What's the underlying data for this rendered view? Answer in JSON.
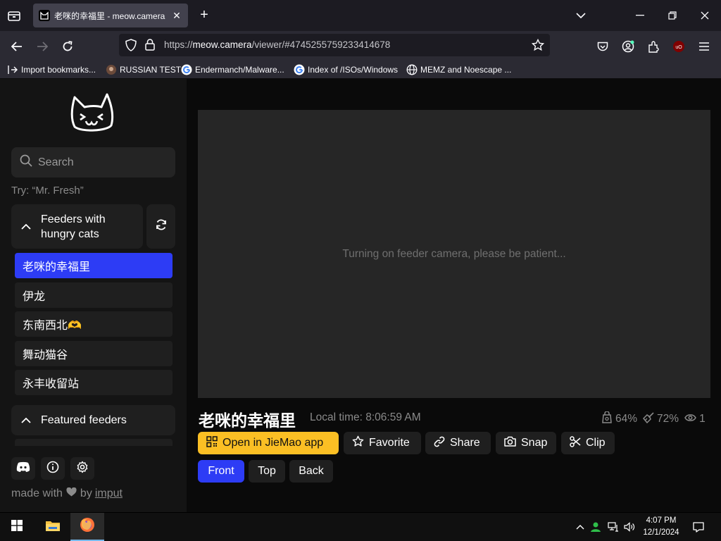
{
  "browser": {
    "tab_title": "老咪的幸福里 - meow.camera",
    "url_prefix": "https://",
    "url_host": "meow.camera",
    "url_path": "/viewer/#4745255759233414678",
    "bookmarks": [
      {
        "label": "Import bookmarks...",
        "icon": "import-icon"
      },
      {
        "label": "RUSSIAN TEST",
        "icon": "site-favicon"
      },
      {
        "label": "Endermanch/Malware...",
        "icon": "google-icon"
      },
      {
        "label": "Index of /ISOs/Windows",
        "icon": "google-icon"
      },
      {
        "label": "MEMZ and Noescape ...",
        "icon": "globe-icon"
      }
    ]
  },
  "sidebar": {
    "search_placeholder": "Search",
    "try_hint": "Try: “Mr. Fresh”",
    "group_hungry": "Feeders with hungry cats",
    "feeders": [
      "老咪的幸福里",
      "伊龙",
      "东南西北🫶",
      "舞动猫谷",
      "永丰收留站"
    ],
    "active_index": 0,
    "group_featured": "Featured feeders",
    "made_with": "made with",
    "by": "by",
    "author": "imput"
  },
  "viewer": {
    "status_message": "Turning on feeder camera, please be patient...",
    "feeder_name": "老咪的幸福里",
    "local_time": "Local time: 8:06:59 AM",
    "food_level": "64%",
    "cleanliness": "72%",
    "viewers": "1",
    "actions": {
      "open_app": "Open in JieMao app",
      "favorite": "Favorite",
      "share": "Share",
      "snap": "Snap",
      "clip": "Clip"
    },
    "cameras": [
      "Front",
      "Top",
      "Back"
    ],
    "active_camera": "Front"
  },
  "taskbar": {
    "time": "4:07 PM",
    "date": "12/1/2024"
  },
  "colors": {
    "accent_blue": "#2d3cf5",
    "accent_yellow": "#fbbf24"
  }
}
